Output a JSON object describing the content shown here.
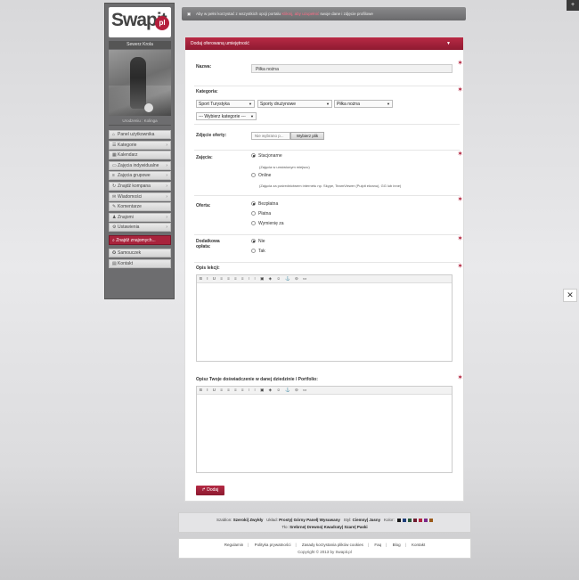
{
  "corner": {
    "plus_icon": "+",
    "tool_icon": "✕"
  },
  "logo": {
    "text": "Swapit",
    "suffix": "pl"
  },
  "user": {
    "name": "Sewerz Krola",
    "meta": "Urodzeniu : Kolinga"
  },
  "menu": [
    {
      "icon": "home-icon",
      "glyph": "⌂",
      "label": "Panel użytkownika",
      "chevron": false
    },
    {
      "icon": "category-icon",
      "glyph": "☰",
      "label": "Kategorie",
      "chevron": true
    },
    {
      "icon": "calendar-icon",
      "glyph": "▦",
      "label": "Kalendarz",
      "chevron": false
    },
    {
      "icon": "individual-icon",
      "glyph": "▭",
      "label": "Zajęcia indywidualne",
      "chevron": true
    },
    {
      "icon": "group-icon",
      "glyph": "≡",
      "label": "Zajęcia grupowe",
      "chevron": true
    },
    {
      "icon": "partner-icon",
      "glyph": "↻",
      "label": "Znajdź kompana",
      "chevron": true
    },
    {
      "icon": "messages-icon",
      "glyph": "✉",
      "label": "Wiadomości",
      "chevron": true
    },
    {
      "icon": "comments-icon",
      "glyph": "✎",
      "label": "Komentarze",
      "chevron": false
    },
    {
      "icon": "friends-icon",
      "glyph": "♟",
      "label": "Znajomi",
      "chevron": true
    },
    {
      "icon": "settings-icon",
      "glyph": "⚙",
      "label": "Ustawienia",
      "chevron": true
    }
  ],
  "search": {
    "label": "Znajdź znajomych..."
  },
  "menu_bottom": [
    {
      "icon": "help-icon",
      "glyph": "✪",
      "label": "Samouczek"
    },
    {
      "icon": "contact-icon",
      "glyph": "▤",
      "label": "Kontakt"
    }
  ],
  "notice": {
    "pre": "Aby w pełni korzystać z wszystkich opcji portalu",
    "link": "Kliknij, aby uzupełnić",
    "post": "swoje dane i zdjęcie profilowe"
  },
  "panel": {
    "title": "Dodaj oferowaną umiejętność",
    "collapse_icon": "▼"
  },
  "form": {
    "name_label": "Nazwa:",
    "name_value": "Piłka nożna",
    "category_label": "Kategoria:",
    "category_selects": [
      "Sport Turystyka",
      "Sporty drużynowe",
      "Piłka nożna"
    ],
    "category_extra": "--- Wybierz kategorie ---",
    "photo_label": "Zdjęcie oferty:",
    "file_text": "Nie wybrano p...",
    "file_button": "Wybierz plik",
    "classes_label": "Zajęcia:",
    "classes_options": [
      "Stacjonarne",
      "Online"
    ],
    "classes_hint1": "(Zajęcia w umówionym miejscu)",
    "classes_hint2": "(Zajęcia za pośrednictwem internetu np. Skype, TeamViewer (Pulpit ekranu), GG lub inne)",
    "offer_label": "Oferta:",
    "offer_options": [
      "Bezpłatna",
      "Płatna",
      "Wymienię za"
    ],
    "extra_label": "Dodatkowa opłata:",
    "extra_options": [
      "Nie",
      "Tak"
    ],
    "desc_label": "Opis lekcji:",
    "exp_label": "Opisz Twoje doświadczenie w danej dziedzinie / Portfolio:",
    "toolbar": "B I U ≡ ≡ ≡ ≡ ⁝ ⁝ ▣ ◈ ☺ ⚓ ⊝ ▭",
    "submit": "Dodaj",
    "submit_icon": "↱"
  },
  "footer_style": {
    "layout_label": "Szablon:",
    "layout_value": "Szeroki| Zwykły",
    "arr_label": "Układ:",
    "arr_value": "Prosty| Górny Panel| Wysuwany",
    "style_label": "Styl:",
    "style_value": "Ciemny| Jasny",
    "color_label": "Kolor:",
    "colors": [
      "#1a1a1a",
      "#1f3f7a",
      "#2d5a3c",
      "#6e1c2f",
      "#b3243f",
      "#7a2a8a",
      "#9a5a1a"
    ],
    "bg_label": "Tło:",
    "bg_value": "Srebrne| Drewno| Kwadraty| Szare| Paski"
  },
  "footer_links": {
    "links": [
      "Regulamin",
      "Polityka prywatności",
      "Zasady korzystania plików cookies",
      "Faq",
      "Blog",
      "Kontakt"
    ],
    "copyright": "Copyright © 2013 by Swapit.pl"
  }
}
